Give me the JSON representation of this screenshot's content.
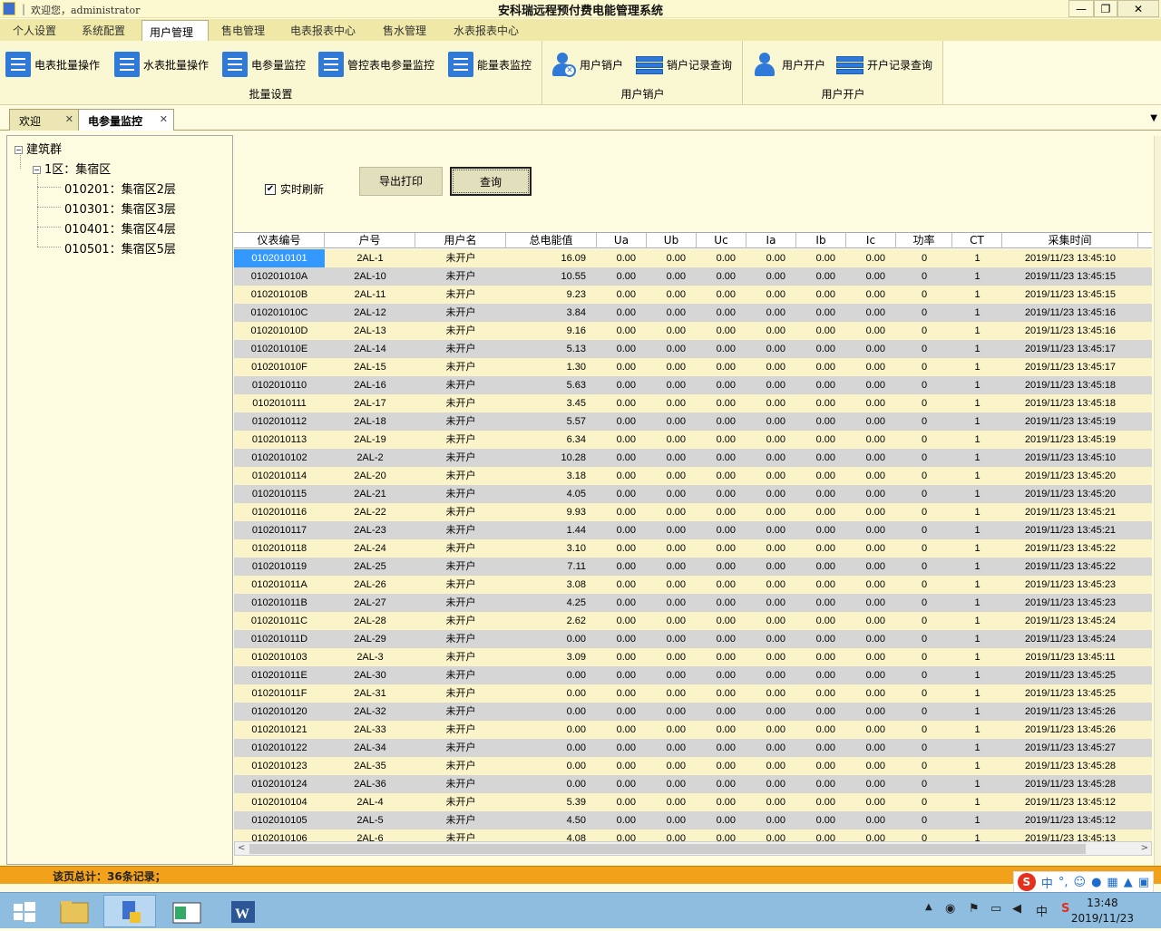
{
  "titlebar": {
    "welcome": "欢迎您，administrator",
    "title": "安科瑞远程预付费电能管理系统",
    "min": "—",
    "max": "❐",
    "close": "✕"
  },
  "menu": [
    "个人设置",
    "系统配置",
    "用户管理",
    "售电管理",
    "电表报表中心",
    "售水管理",
    "水表报表中心"
  ],
  "menu_active": "用户管理",
  "ribbon": {
    "groups": [
      {
        "label": "批量设置",
        "buttons": [
          "电表批量操作",
          "水表批量操作",
          "电参量监控",
          "管控表电参量监控",
          "能量表监控"
        ]
      },
      {
        "label": "用户销户",
        "buttons": [
          "用户销户",
          "销户记录查询"
        ]
      },
      {
        "label": "用户开户",
        "buttons": [
          "用户开户",
          "开户记录查询"
        ]
      }
    ]
  },
  "doctabs": [
    {
      "label": "欢迎"
    },
    {
      "label": "电参量监控"
    }
  ],
  "tree": {
    "root": "建筑群",
    "zone": "1区：集宿区",
    "floors": [
      "010201：集宿区2层",
      "010301：集宿区3层",
      "010401：集宿区4层",
      "010501：集宿区5层"
    ]
  },
  "controls": {
    "realtime_label": "实时刷新",
    "realtime_checked": true,
    "check_mark": "✔",
    "export_label": "导出打印",
    "query_label": "查询"
  },
  "grid": {
    "columns": [
      "仪表编号",
      "户号",
      "用户名",
      "总电能值",
      "Ua",
      "Ub",
      "Uc",
      "Ia",
      "Ib",
      "Ic",
      "功率",
      "CT",
      "采集时间"
    ],
    "rows": [
      [
        "0102010101",
        "2AL-1",
        "未开户",
        "16.09",
        "0.00",
        "0.00",
        "0.00",
        "0.00",
        "0.00",
        "0.00",
        "0",
        "1",
        "2019/11/23 13:45:10"
      ],
      [
        "010201010A",
        "2AL-10",
        "未开户",
        "10.55",
        "0.00",
        "0.00",
        "0.00",
        "0.00",
        "0.00",
        "0.00",
        "0",
        "1",
        "2019/11/23 13:45:15"
      ],
      [
        "010201010B",
        "2AL-11",
        "未开户",
        "9.23",
        "0.00",
        "0.00",
        "0.00",
        "0.00",
        "0.00",
        "0.00",
        "0",
        "1",
        "2019/11/23 13:45:15"
      ],
      [
        "010201010C",
        "2AL-12",
        "未开户",
        "3.84",
        "0.00",
        "0.00",
        "0.00",
        "0.00",
        "0.00",
        "0.00",
        "0",
        "1",
        "2019/11/23 13:45:16"
      ],
      [
        "010201010D",
        "2AL-13",
        "未开户",
        "9.16",
        "0.00",
        "0.00",
        "0.00",
        "0.00",
        "0.00",
        "0.00",
        "0",
        "1",
        "2019/11/23 13:45:16"
      ],
      [
        "010201010E",
        "2AL-14",
        "未开户",
        "5.13",
        "0.00",
        "0.00",
        "0.00",
        "0.00",
        "0.00",
        "0.00",
        "0",
        "1",
        "2019/11/23 13:45:17"
      ],
      [
        "010201010F",
        "2AL-15",
        "未开户",
        "1.30",
        "0.00",
        "0.00",
        "0.00",
        "0.00",
        "0.00",
        "0.00",
        "0",
        "1",
        "2019/11/23 13:45:17"
      ],
      [
        "0102010110",
        "2AL-16",
        "未开户",
        "5.63",
        "0.00",
        "0.00",
        "0.00",
        "0.00",
        "0.00",
        "0.00",
        "0",
        "1",
        "2019/11/23 13:45:18"
      ],
      [
        "0102010111",
        "2AL-17",
        "未开户",
        "3.45",
        "0.00",
        "0.00",
        "0.00",
        "0.00",
        "0.00",
        "0.00",
        "0",
        "1",
        "2019/11/23 13:45:18"
      ],
      [
        "0102010112",
        "2AL-18",
        "未开户",
        "5.57",
        "0.00",
        "0.00",
        "0.00",
        "0.00",
        "0.00",
        "0.00",
        "0",
        "1",
        "2019/11/23 13:45:19"
      ],
      [
        "0102010113",
        "2AL-19",
        "未开户",
        "6.34",
        "0.00",
        "0.00",
        "0.00",
        "0.00",
        "0.00",
        "0.00",
        "0",
        "1",
        "2019/11/23 13:45:19"
      ],
      [
        "0102010102",
        "2AL-2",
        "未开户",
        "10.28",
        "0.00",
        "0.00",
        "0.00",
        "0.00",
        "0.00",
        "0.00",
        "0",
        "1",
        "2019/11/23 13:45:10"
      ],
      [
        "0102010114",
        "2AL-20",
        "未开户",
        "3.18",
        "0.00",
        "0.00",
        "0.00",
        "0.00",
        "0.00",
        "0.00",
        "0",
        "1",
        "2019/11/23 13:45:20"
      ],
      [
        "0102010115",
        "2AL-21",
        "未开户",
        "4.05",
        "0.00",
        "0.00",
        "0.00",
        "0.00",
        "0.00",
        "0.00",
        "0",
        "1",
        "2019/11/23 13:45:20"
      ],
      [
        "0102010116",
        "2AL-22",
        "未开户",
        "9.93",
        "0.00",
        "0.00",
        "0.00",
        "0.00",
        "0.00",
        "0.00",
        "0",
        "1",
        "2019/11/23 13:45:21"
      ],
      [
        "0102010117",
        "2AL-23",
        "未开户",
        "1.44",
        "0.00",
        "0.00",
        "0.00",
        "0.00",
        "0.00",
        "0.00",
        "0",
        "1",
        "2019/11/23 13:45:21"
      ],
      [
        "0102010118",
        "2AL-24",
        "未开户",
        "3.10",
        "0.00",
        "0.00",
        "0.00",
        "0.00",
        "0.00",
        "0.00",
        "0",
        "1",
        "2019/11/23 13:45:22"
      ],
      [
        "0102010119",
        "2AL-25",
        "未开户",
        "7.11",
        "0.00",
        "0.00",
        "0.00",
        "0.00",
        "0.00",
        "0.00",
        "0",
        "1",
        "2019/11/23 13:45:22"
      ],
      [
        "010201011A",
        "2AL-26",
        "未开户",
        "3.08",
        "0.00",
        "0.00",
        "0.00",
        "0.00",
        "0.00",
        "0.00",
        "0",
        "1",
        "2019/11/23 13:45:23"
      ],
      [
        "010201011B",
        "2AL-27",
        "未开户",
        "4.25",
        "0.00",
        "0.00",
        "0.00",
        "0.00",
        "0.00",
        "0.00",
        "0",
        "1",
        "2019/11/23 13:45:23"
      ],
      [
        "010201011C",
        "2AL-28",
        "未开户",
        "2.62",
        "0.00",
        "0.00",
        "0.00",
        "0.00",
        "0.00",
        "0.00",
        "0",
        "1",
        "2019/11/23 13:45:24"
      ],
      [
        "010201011D",
        "2AL-29",
        "未开户",
        "0.00",
        "0.00",
        "0.00",
        "0.00",
        "0.00",
        "0.00",
        "0.00",
        "0",
        "1",
        "2019/11/23 13:45:24"
      ],
      [
        "0102010103",
        "2AL-3",
        "未开户",
        "3.09",
        "0.00",
        "0.00",
        "0.00",
        "0.00",
        "0.00",
        "0.00",
        "0",
        "1",
        "2019/11/23 13:45:11"
      ],
      [
        "010201011E",
        "2AL-30",
        "未开户",
        "0.00",
        "0.00",
        "0.00",
        "0.00",
        "0.00",
        "0.00",
        "0.00",
        "0",
        "1",
        "2019/11/23 13:45:25"
      ],
      [
        "010201011F",
        "2AL-31",
        "未开户",
        "0.00",
        "0.00",
        "0.00",
        "0.00",
        "0.00",
        "0.00",
        "0.00",
        "0",
        "1",
        "2019/11/23 13:45:25"
      ],
      [
        "0102010120",
        "2AL-32",
        "未开户",
        "0.00",
        "0.00",
        "0.00",
        "0.00",
        "0.00",
        "0.00",
        "0.00",
        "0",
        "1",
        "2019/11/23 13:45:26"
      ],
      [
        "0102010121",
        "2AL-33",
        "未开户",
        "0.00",
        "0.00",
        "0.00",
        "0.00",
        "0.00",
        "0.00",
        "0.00",
        "0",
        "1",
        "2019/11/23 13:45:26"
      ],
      [
        "0102010122",
        "2AL-34",
        "未开户",
        "0.00",
        "0.00",
        "0.00",
        "0.00",
        "0.00",
        "0.00",
        "0.00",
        "0",
        "1",
        "2019/11/23 13:45:27"
      ],
      [
        "0102010123",
        "2AL-35",
        "未开户",
        "0.00",
        "0.00",
        "0.00",
        "0.00",
        "0.00",
        "0.00",
        "0.00",
        "0",
        "1",
        "2019/11/23 13:45:28"
      ],
      [
        "0102010124",
        "2AL-36",
        "未开户",
        "0.00",
        "0.00",
        "0.00",
        "0.00",
        "0.00",
        "0.00",
        "0.00",
        "0",
        "1",
        "2019/11/23 13:45:28"
      ],
      [
        "0102010104",
        "2AL-4",
        "未开户",
        "5.39",
        "0.00",
        "0.00",
        "0.00",
        "0.00",
        "0.00",
        "0.00",
        "0",
        "1",
        "2019/11/23 13:45:12"
      ],
      [
        "0102010105",
        "2AL-5",
        "未开户",
        "4.50",
        "0.00",
        "0.00",
        "0.00",
        "0.00",
        "0.00",
        "0.00",
        "0",
        "1",
        "2019/11/23 13:45:12"
      ],
      [
        "0102010106",
        "2AL-6",
        "未开户",
        "4.08",
        "0.00",
        "0.00",
        "0.00",
        "0.00",
        "0.00",
        "0.00",
        "0",
        "1",
        "2019/11/23 13:45:13"
      ]
    ],
    "selected_row": 0,
    "colors": {
      "odd": "#fbf4c8",
      "even": "#d6d6d6",
      "selected": "#3399ff"
    }
  },
  "status": {
    "text": "该页总计：36条记录；"
  },
  "taskbar": {
    "time": "13:48",
    "date": "2019/11/23",
    "ime": "中"
  }
}
